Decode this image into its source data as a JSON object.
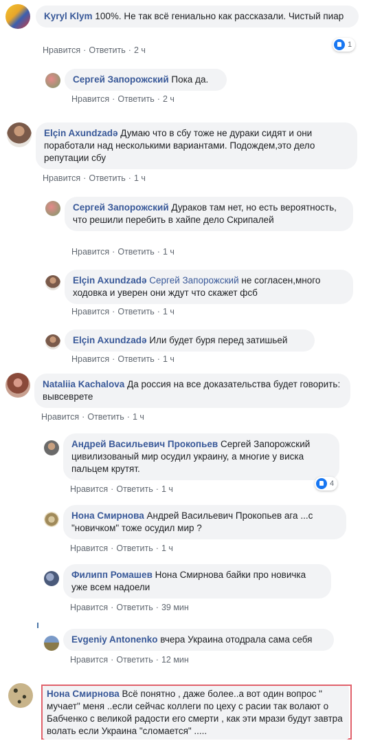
{
  "actions": {
    "like": "Нравится",
    "reply": "Ответить",
    "sep": "·"
  },
  "comments": [
    {
      "author": "Kyryl Klym",
      "text": "100%. Не так всё гениально как рассказали. Чистый пиар",
      "time": "2 ч",
      "reactions": "1"
    },
    {
      "author": "Сергей Запорожский",
      "text": "Пока да.",
      "time": "2 ч"
    },
    {
      "author": "Elçin Axundzadə",
      "text": "Думаю что в сбу тоже не дураки сидят и они поработали над несколькими вариантами. Подождем,это дело репутации сбу",
      "time": "1 ч"
    },
    {
      "author": "Сергей Запорожский",
      "text": "Дураков там нет, но есть вероятность, что решили перебить в хайпе дело Скрипалей",
      "time": "1 ч"
    },
    {
      "author": "Elçin Axundzadə",
      "mention": "Сергей Запорожский",
      "text": "не согласен,много ходовка и уверен они ждут что скажет фсб",
      "time": "1 ч"
    },
    {
      "author": "Elçin Axundzadə",
      "text": "Или будет буря перед затишьей",
      "time": "1 ч"
    },
    {
      "author": "Nataliia Kachalova",
      "text": "Да россия на все доказательства будет говорить: вывсеврете",
      "time": "1 ч"
    },
    {
      "author": "Андрей Васильевич Прокопьев",
      "text": "Сергей Запорожский цивилизованый мир осудил украину, а многие у виска пальцем крутят.",
      "time": "1 ч",
      "reactions": "4"
    },
    {
      "author": "Нона Смирнова",
      "text": "Андрей Васильевич Прокопьев ага ...с \"новичком\" тоже осудил мир ?",
      "time": "1 ч"
    },
    {
      "author": "Филипп Ромашев",
      "text": "Нона Смирнова байки про новичка уже всем надоели",
      "time": "39 мин"
    },
    {
      "author": "Evgeniy Antonenko",
      "text": "вчера Украина отодрала сама себя",
      "time": "12 мин"
    },
    {
      "author": "Нона Смирнова",
      "text": "Всё понятно , даже более..а вот один вопрос \" мучает\" меня ..если сейчас коллеги по цеху с расии так волают о Бабченко с великой радости его смерти , как эти мрази будут завтра волать если Украина \"сломается\" ....."
    }
  ],
  "colors": {
    "author": "#385898",
    "bubble": "#f2f3f5",
    "meta": "#606770",
    "highlight": "#e0606a",
    "like": "#1877f2"
  }
}
